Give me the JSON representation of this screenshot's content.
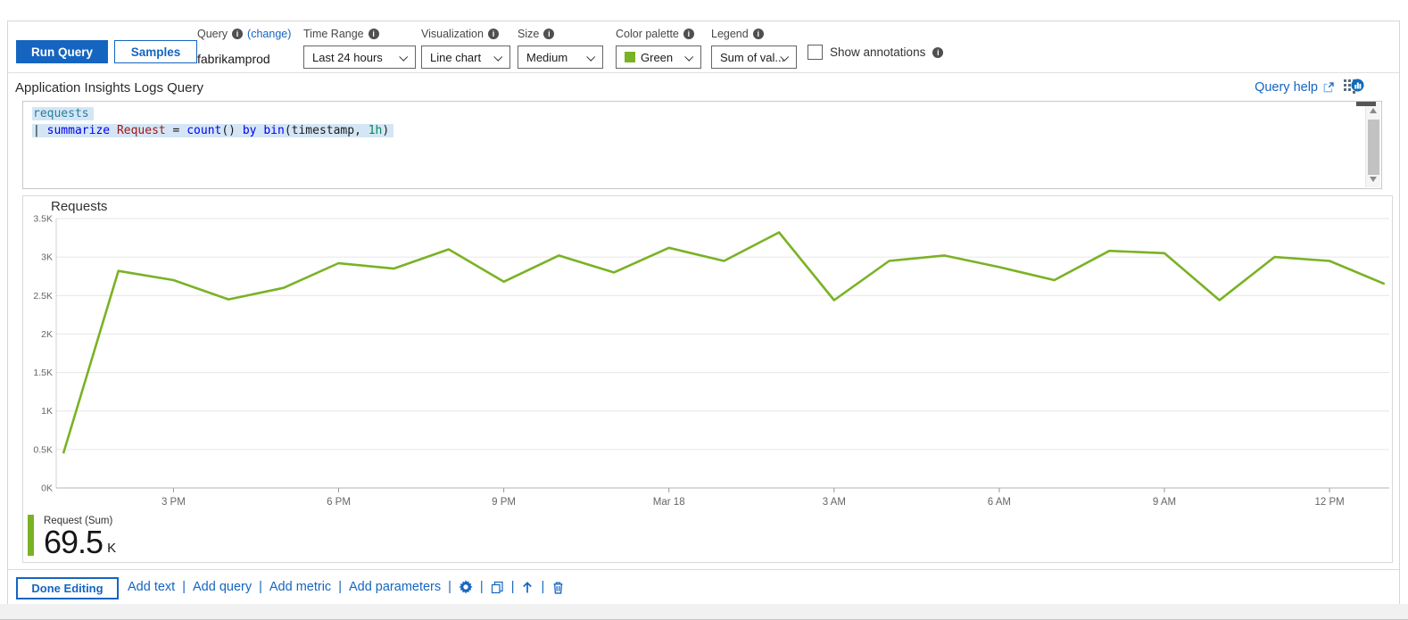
{
  "colors": {
    "accent": "#1565c0",
    "green": "#7ab225"
  },
  "toolbar": {
    "run_query_label": "Run Query",
    "samples_label": "Samples",
    "query": {
      "label": "Query",
      "change_link": "(change)",
      "value": "fabrikamprod"
    },
    "time_range": {
      "label": "Time Range",
      "value": "Last 24 hours"
    },
    "visualization": {
      "label": "Visualization",
      "value": "Line chart"
    },
    "size": {
      "label": "Size",
      "value": "Medium"
    },
    "color_palette": {
      "label": "Color palette",
      "value": "Green",
      "swatch": "#7ab225"
    },
    "legend": {
      "label": "Legend",
      "value": "Sum of val..."
    },
    "show_annotations_label": "Show annotations",
    "info_glyph": "i"
  },
  "section": {
    "title": "Application Insights Logs Query",
    "help_link": "Query help"
  },
  "editor": {
    "query_text": "requests\n| summarize Request = count() by bin(timestamp, 1h)",
    "lines": [
      [
        [
          "requests",
          "tbl"
        ]
      ],
      [
        [
          "| ",
          "pl"
        ],
        [
          "summarize",
          "kw"
        ],
        [
          " ",
          "pl"
        ],
        [
          "Request",
          "col"
        ],
        [
          " = ",
          "pl"
        ],
        [
          "count",
          "kw"
        ],
        [
          "() ",
          "pl"
        ],
        [
          "by",
          "kw"
        ],
        [
          " ",
          "pl"
        ],
        [
          "bin",
          "kw"
        ],
        [
          "(timestamp, ",
          "pl"
        ],
        [
          "1h",
          "num"
        ],
        [
          ")",
          "pl"
        ]
      ]
    ]
  },
  "chart_data": {
    "type": "line",
    "title": "Requests",
    "bin": "1h",
    "x_tick_labels": [
      "3 PM",
      "6 PM",
      "9 PM",
      "Mar 18",
      "3 AM",
      "6 AM",
      "9 AM",
      "12 PM"
    ],
    "x_tick_indices": [
      2,
      5,
      8,
      11,
      14,
      17,
      20,
      23
    ],
    "y_tick_labels": [
      "0K",
      "0.5K",
      "1K",
      "1.5K",
      "2K",
      "2.5K",
      "3K",
      "3.5K"
    ],
    "y_tick_values": [
      0,
      500,
      1000,
      1500,
      2000,
      2500,
      3000,
      3500
    ],
    "ylim": [
      0,
      3500
    ],
    "grid": true,
    "legend_position": "bottom-left",
    "series": [
      {
        "name": "Request (Sum)",
        "color": "#7ab225",
        "values": [
          450,
          2820,
          2700,
          2450,
          2600,
          2920,
          2850,
          3100,
          2680,
          3020,
          2800,
          3120,
          2950,
          3320,
          2440,
          2950,
          3020,
          2870,
          2700,
          3080,
          3050,
          2440,
          3000,
          2950,
          2650
        ]
      }
    ],
    "total_label": "69.5 K"
  },
  "chart_legend": {
    "name": "Request (Sum)",
    "value": "69.5",
    "unit": "K"
  },
  "footer": {
    "done_label": "Done Editing",
    "links": [
      "Add text",
      "Add query",
      "Add metric",
      "Add parameters"
    ],
    "sep": "|"
  }
}
